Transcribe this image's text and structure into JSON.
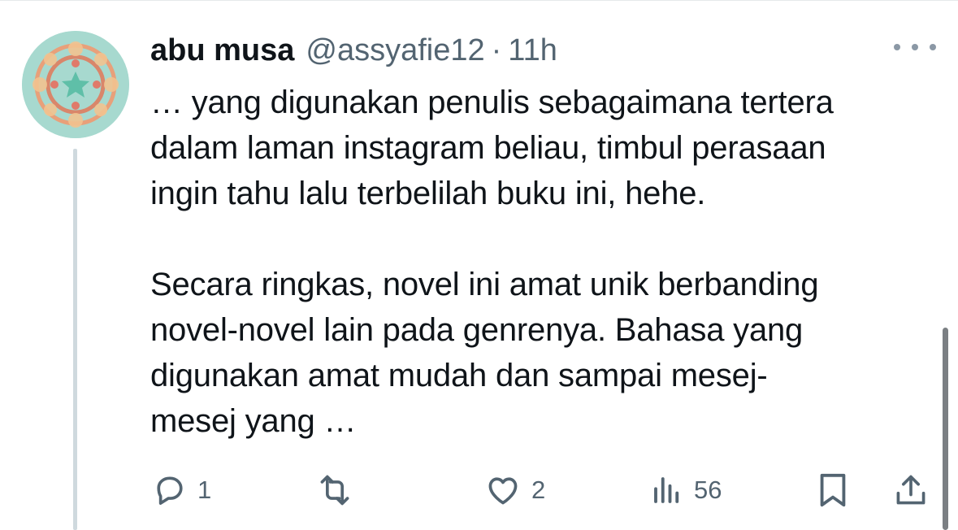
{
  "tweet": {
    "author_name": "abu musa",
    "handle": "@assyafie12",
    "separator": "·",
    "time": "11h",
    "paragraphs": [
      "… yang digunakan penulis sebagaimana tertera\ndalam laman instagram beliau, timbul perasaan\ningin tahu lalu terbelilah buku ini, hehe.",
      "Secara ringkas, novel ini amat unik berbanding\nnovel-novel lain pada genrenya. Bahasa yang\ndigunakan amat mudah dan sampai mesej-\nmesej yang …"
    ]
  },
  "actions": {
    "reply_count": "1",
    "repost_count": "",
    "like_count": "2",
    "views_count": "56"
  },
  "icons": {
    "more": "more-horizontal-icon",
    "reply": "reply-bubble-icon",
    "repost": "repost-icon",
    "like": "heart-icon",
    "views": "analytics-bars-icon",
    "bookmark": "bookmark-icon",
    "share": "share-upload-icon"
  },
  "colors": {
    "text": "#0f1419",
    "secondary": "#536471",
    "thread_line": "#cfd9de",
    "avatar_bg": "#a7d9cf"
  }
}
